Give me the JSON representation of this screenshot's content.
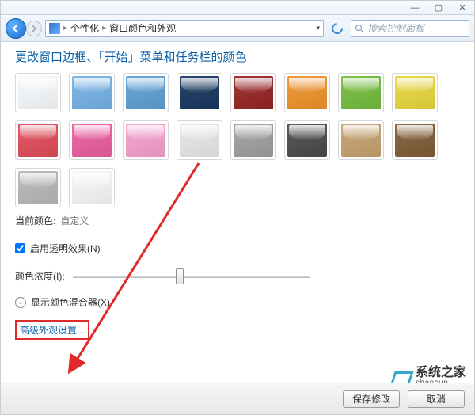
{
  "titlebar": {
    "minimize": "—",
    "maximize": "▢",
    "close": "✕"
  },
  "nav": {
    "breadcrumb1": "个性化",
    "breadcrumb2": "窗口颜色和外观"
  },
  "search": {
    "placeholder": "搜索控制面板"
  },
  "page_title": "更改窗口边框、「开始」菜单和任务栏的颜色",
  "colors": [
    "#f7fafc",
    "#7fb7e8",
    "#6aa7d7",
    "#2a466a",
    "#9f3636",
    "#f09a3c",
    "#7fc24b",
    "#e8da4b",
    "#e25a66",
    "#ec6aa7",
    "#f5a7d0",
    "#e9e9e9",
    "#a7a7a7",
    "#595959",
    "#c9a97a",
    "#8a6a46",
    "#bdbdbd",
    "#f8f8f8"
  ],
  "current_color_label": "当前颜色:",
  "current_color_value": "自定义",
  "enable_transparency_label": "启用透明效果(N)",
  "enable_transparency_checked": true,
  "intensity_label": "颜色浓度(I):",
  "mixer_label": "显示颜色混合器(X)",
  "advanced_link": "高级外观设置...",
  "footer": {
    "save": "保存修改",
    "cancel": "取消"
  },
  "watermark": {
    "cn": "系统之家",
    "en": "shancun"
  }
}
